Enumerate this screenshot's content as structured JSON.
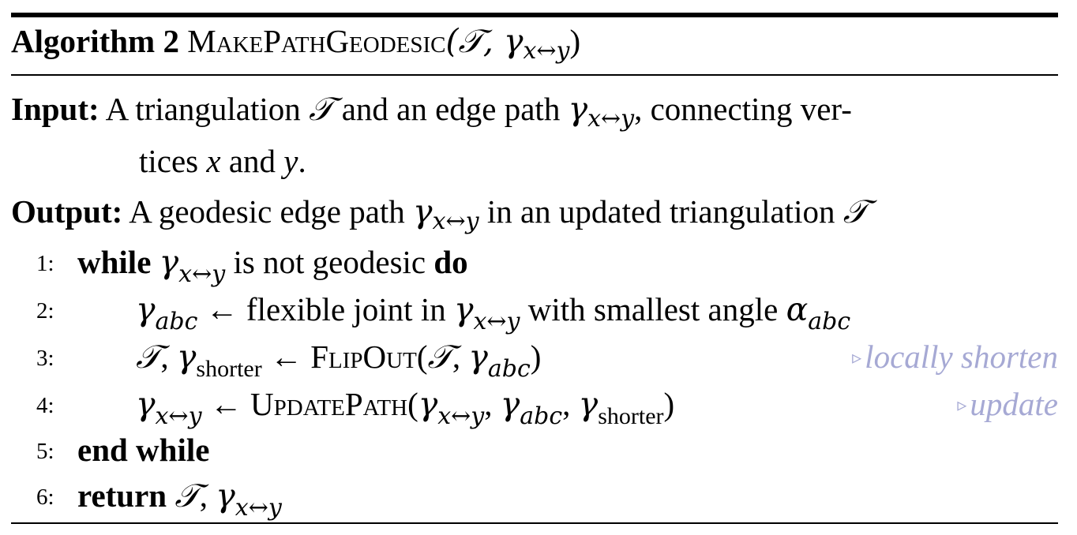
{
  "header": {
    "label": "Algorithm 2",
    "name": "MakePathGeodesic",
    "args": "(𝒯, γ",
    "args_sub": "x↔y",
    "args_close": ")"
  },
  "input": {
    "label": "Input:",
    "text1": "A triangulation ",
    "T": "𝒯",
    "text2": " and an edge path ",
    "gamma": "γ",
    "gamma_sub": "x↔y",
    "text3": ", connecting ver-",
    "cont1": "tices ",
    "x": "x",
    "cont2": " and ",
    "y": "y",
    "cont3": "."
  },
  "output": {
    "label": "Output:",
    "text1": "A geodesic edge path ",
    "gamma": "γ",
    "gamma_sub": "x↔y",
    "text2": " in an updated triangulation ",
    "T": "𝒯"
  },
  "steps": [
    {
      "num": "1:",
      "kw1": "while",
      "gamma": "γ",
      "gamma_sub": "x↔y",
      "text": " is not geodesic ",
      "kw2": "do"
    },
    {
      "num": "2:",
      "g": "γ",
      "g_sub": "abc",
      "arrow": " ← flexible joint in ",
      "g2": "γ",
      "g2_sub": "x↔y",
      "text": " with smallest angle ",
      "alpha": "α",
      "alpha_sub": "abc"
    },
    {
      "num": "3:",
      "T": "𝒯",
      "comma": ", ",
      "g": "γ",
      "g_sub": "shorter",
      "arrow": " ← ",
      "fn": "FlipOut",
      "open": "(",
      "T2": "𝒯",
      "comma2": ", ",
      "g2": "γ",
      "g2_sub": "abc",
      "close": ")",
      "comment": "locally shorten"
    },
    {
      "num": "4:",
      "g": "γ",
      "g_sub": "x↔y",
      "arrow": " ← ",
      "fn": "UpdatePath",
      "open": "(",
      "a1": "γ",
      "a1_sub": "x↔y",
      "c1": ", ",
      "a2": "γ",
      "a2_sub": "abc",
      "c2": ", ",
      "a3": "γ",
      "a3_sub": "shorter",
      "close": ")",
      "comment": "update"
    },
    {
      "num": "5:",
      "kw": "end while"
    },
    {
      "num": "6:",
      "kw": "return",
      "T": "𝒯",
      "comma": ", ",
      "g": "γ",
      "g_sub": "x↔y"
    }
  ],
  "comment_marker": "▹",
  "colors": {
    "comment": "#a6a9d4",
    "text": "#000000"
  }
}
